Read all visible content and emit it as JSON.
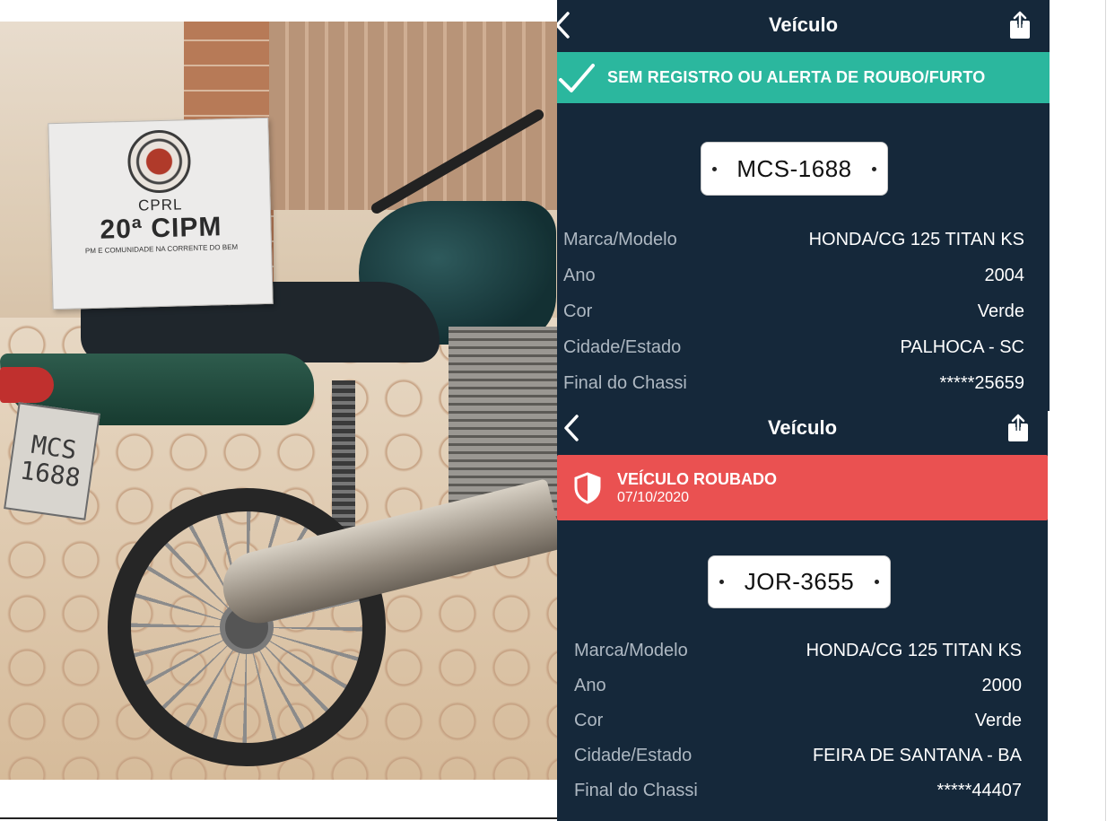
{
  "top": {
    "nav_title": "Veículo",
    "banner_text": "SEM REGISTRO OU ALERTA DE ROUBO/FURTO",
    "plate": "MCS-1688",
    "rows": [
      {
        "label": "Marca/Modelo",
        "value": "HONDA/CG 125 TITAN KS"
      },
      {
        "label": "Ano",
        "value": "2004"
      },
      {
        "label": "Cor",
        "value": "Verde"
      },
      {
        "label": "Cidade/Estado",
        "value": "PALHOCA - SC"
      },
      {
        "label": "Final do Chassi",
        "value": "*****25659"
      }
    ],
    "colors": {
      "background": "#15283a",
      "banner": "#2bb79e"
    }
  },
  "bottom": {
    "nav_title": "Veículo",
    "alert_title": "VEÍCULO ROUBADO",
    "alert_date": "07/10/2020",
    "plate": "JOR-3655",
    "rows": [
      {
        "label": "Marca/Modelo",
        "value": "HONDA/CG 125 TITAN KS"
      },
      {
        "label": "Ano",
        "value": "2000"
      },
      {
        "label": "Cor",
        "value": "Verde"
      },
      {
        "label": "Cidade/Estado",
        "value": "FEIRA DE SANTANA - BA"
      },
      {
        "label": "Final do Chassi",
        "value": "*****44407"
      }
    ],
    "colors": {
      "background": "#15283a",
      "banner": "#ea5151"
    }
  },
  "photo": {
    "sign_line1": "CPRL",
    "sign_line2": "20ª CIPM",
    "sign_line3": "PM E COMUNIDADE NA CORRENTE DO BEM",
    "motorcycle_plate": "MCS\n1688"
  },
  "icons": {
    "back": "back-icon",
    "share": "share-icon",
    "check": "check-icon",
    "shield": "shield-icon"
  }
}
